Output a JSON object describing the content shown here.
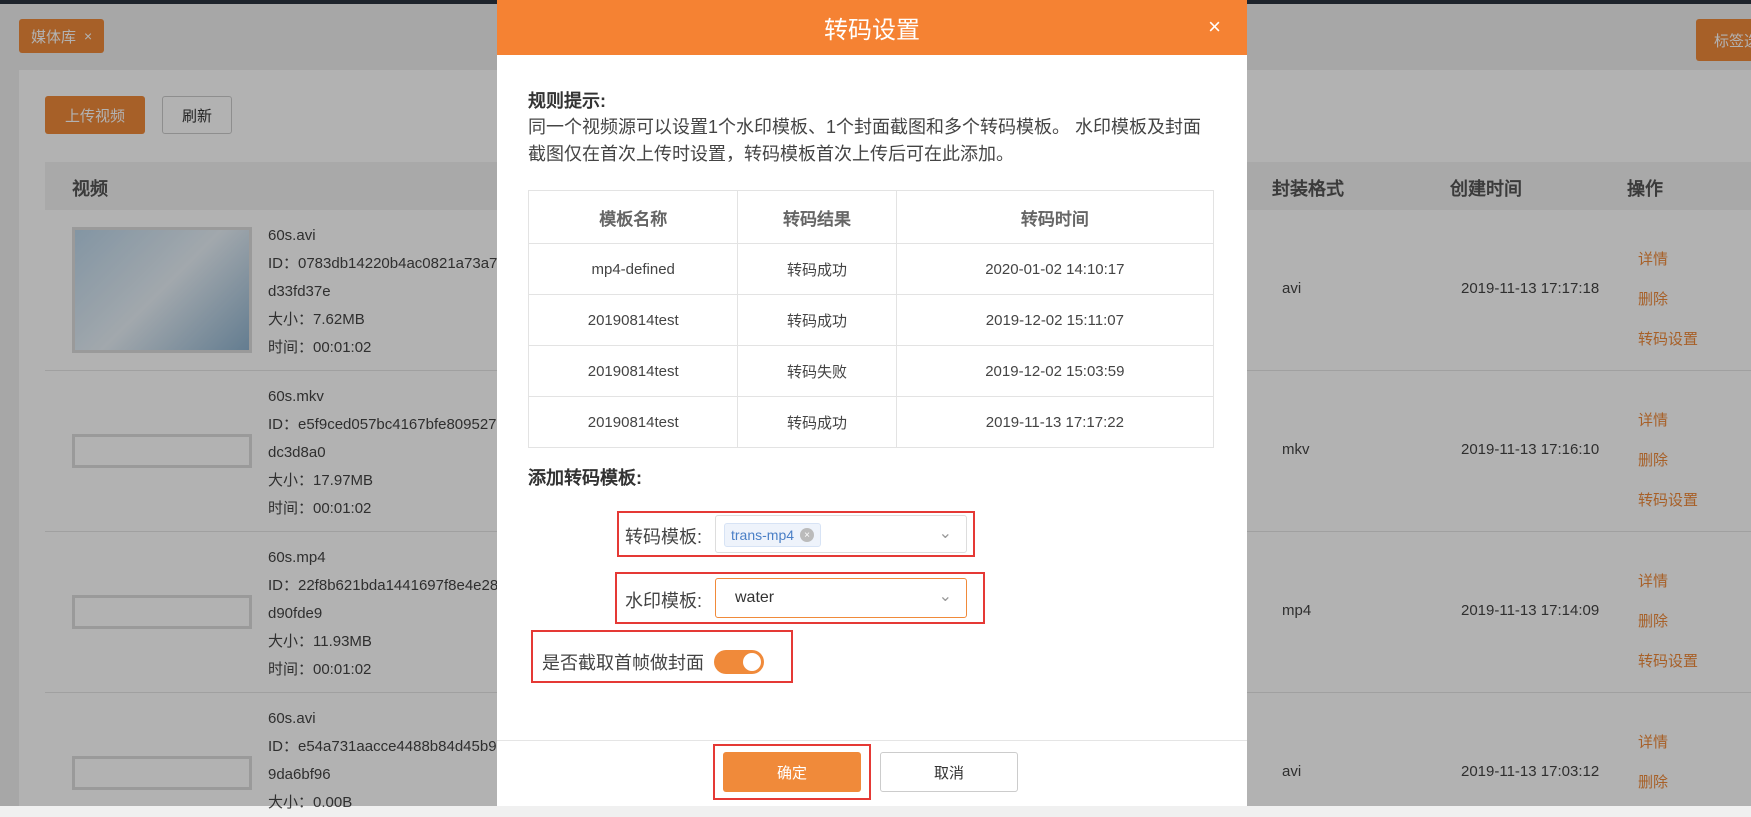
{
  "tab": {
    "label": "媒体库",
    "close": "×"
  },
  "right_tab": {
    "label": "标签选"
  },
  "toolbar": {
    "upload": "上传视频",
    "refresh": "刷新"
  },
  "table_headers": {
    "video": "视频",
    "format": "封装格式",
    "created": "创建时间",
    "ops": "操作"
  },
  "ops": {
    "detail": "详情",
    "delete": "删除",
    "transcode": "转码设置"
  },
  "rows": [
    {
      "name": "60s.avi",
      "id1": "ID：0783db14220b4ac0821a73a7",
      "id2": "d33fd37e",
      "size": "大小：7.62MB",
      "time": "时间：00:01:02",
      "format": "avi",
      "created": "2019-11-13 17:17:18"
    },
    {
      "name": "60s.mkv",
      "id1": "ID：e5f9ced057bc4167bfe809527",
      "id2": "dc3d8a0",
      "size": "大小：17.97MB",
      "time": "时间：00:01:02",
      "format": "mkv",
      "created": "2019-11-13 17:16:10"
    },
    {
      "name": "60s.mp4",
      "id1": "ID：22f8b621bda1441697f8e4e28",
      "id2": "d90fde9",
      "size": "大小：11.93MB",
      "time": "时间：00:01:02",
      "format": "mp4",
      "created": "2019-11-13 17:14:09"
    },
    {
      "name": "60s.avi",
      "id1": "ID：e54a731aacce4488b84d45b9",
      "id2": "9da6bf96",
      "size": "大小：0.00B",
      "time": "",
      "format": "avi",
      "created": "2019-11-13 17:03:12"
    }
  ],
  "modal": {
    "title": "转码设置",
    "close": "×",
    "rule_title": "规则提示:",
    "rule_text": "同一个视频源可以设置1个水印模板、1个封面截图和多个转码模板。 水印模板及封面截图仅在首次上传时设置，转码模板首次上传后可在此添加。",
    "table_headers": [
      "模板名称",
      "转码结果",
      "转码时间"
    ],
    "table_rows": [
      [
        "mp4-defined",
        "转码成功",
        "2020-01-02 14:10:17"
      ],
      [
        "20190814test",
        "转码成功",
        "2019-12-02 15:11:07"
      ],
      [
        "20190814test",
        "转码失败",
        "2019-12-02 15:03:59"
      ],
      [
        "20190814test",
        "转码成功",
        "2019-11-13 17:17:22"
      ]
    ],
    "add_title": "添加转码模板:",
    "transcode_label": "转码模板:",
    "transcode_chip": "trans-mp4",
    "watermark_label": "水印模板:",
    "watermark_value": "water",
    "cover_label": "是否截取首帧做封面",
    "cover_enabled": true,
    "ok": "确定",
    "cancel": "取消"
  },
  "colors": {
    "accent": "#f08a3a",
    "header": "#f58233",
    "highlight": "#e53935"
  }
}
